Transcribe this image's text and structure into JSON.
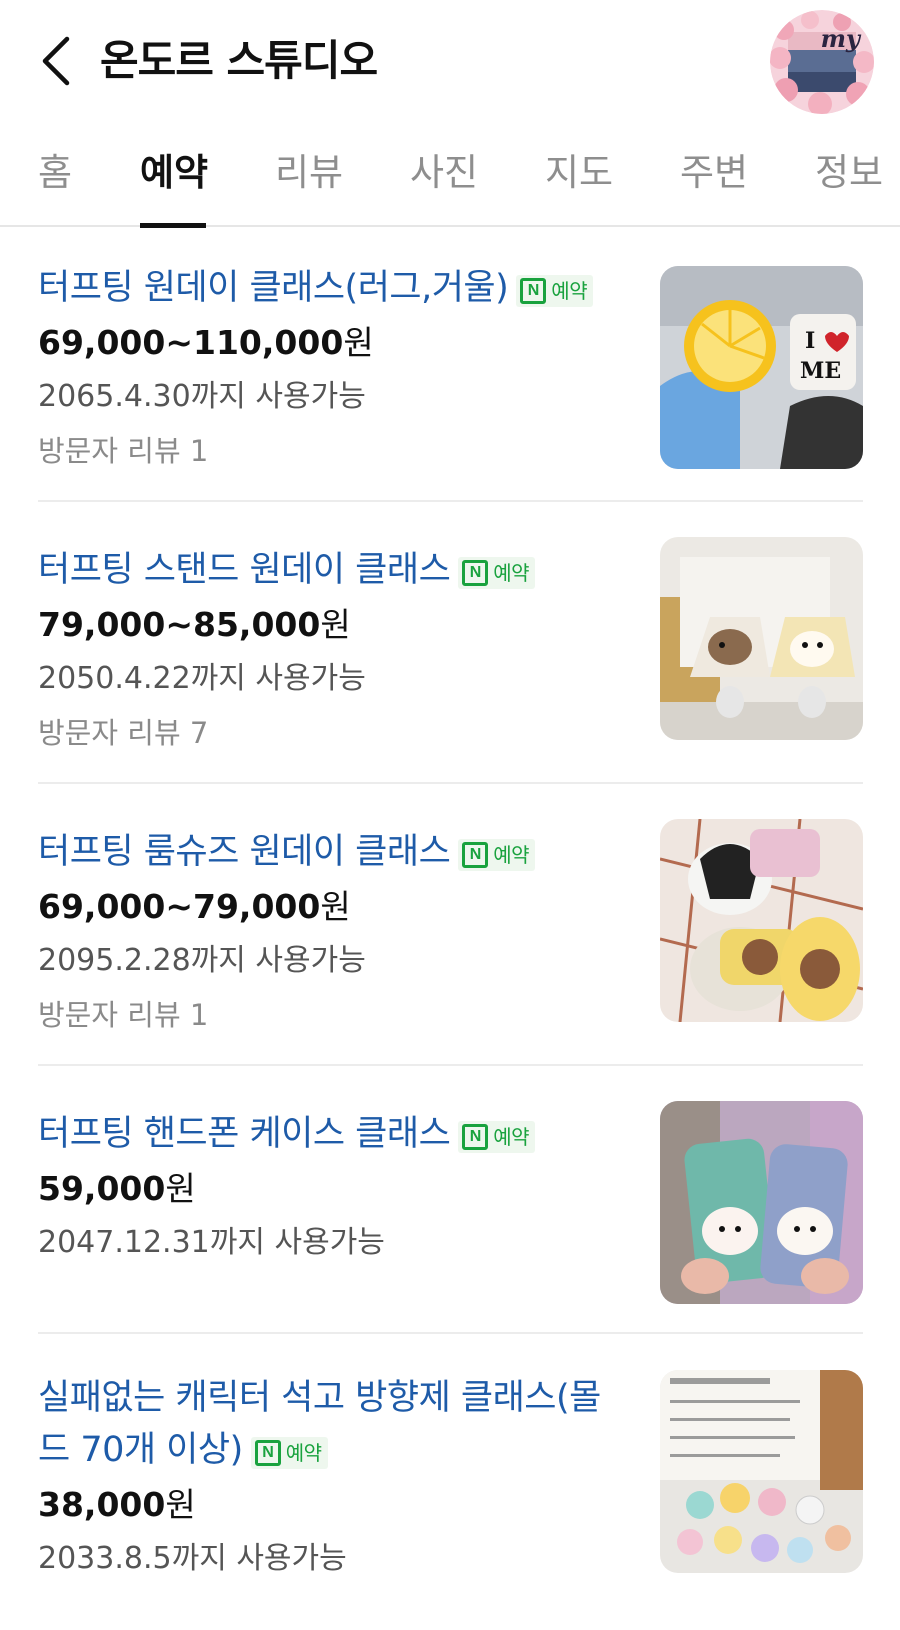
{
  "header": {
    "title": "온도르 스튜디오",
    "back_icon": "chevron-left-icon",
    "avatar_label": "my"
  },
  "tabs": [
    {
      "label": "홈",
      "active": false
    },
    {
      "label": "예약",
      "active": true
    },
    {
      "label": "리뷰",
      "active": false
    },
    {
      "label": "사진",
      "active": false
    },
    {
      "label": "지도",
      "active": false
    },
    {
      "label": "주변",
      "active": false
    },
    {
      "label": "정보",
      "active": false
    }
  ],
  "badge": {
    "letter": "N",
    "text": "예약",
    "color": "#19a23e"
  },
  "colors": {
    "link": "#1e5ba8",
    "accent_green": "#19a23e"
  },
  "items": [
    {
      "title": "터프팅 원데이 클래스(러그,거울)",
      "price": "69,000~110,000",
      "unit": "원",
      "period": "2065.4.30까지 사용가능",
      "reviews": "방문자 리뷰 1"
    },
    {
      "title": "터프팅 스탠드 원데이 클래스",
      "price": "79,000~85,000",
      "unit": "원",
      "period": "2050.4.22까지 사용가능",
      "reviews": "방문자 리뷰 7"
    },
    {
      "title": "터프팅 룸슈즈 원데이 클래스",
      "price": "69,000~79,000",
      "unit": "원",
      "period": "2095.2.28까지 사용가능",
      "reviews": "방문자 리뷰 1"
    },
    {
      "title": "터프팅 핸드폰 케이스 클래스",
      "price": "59,000",
      "unit": "원",
      "period": "2047.12.31까지 사용가능",
      "reviews": ""
    },
    {
      "title": "실패없는 캐릭터 석고 방향제 클래스(몰드 70개 이상)",
      "price": "38,000",
      "unit": "원",
      "period": "2033.8.5까지 사용가능",
      "reviews": ""
    }
  ]
}
